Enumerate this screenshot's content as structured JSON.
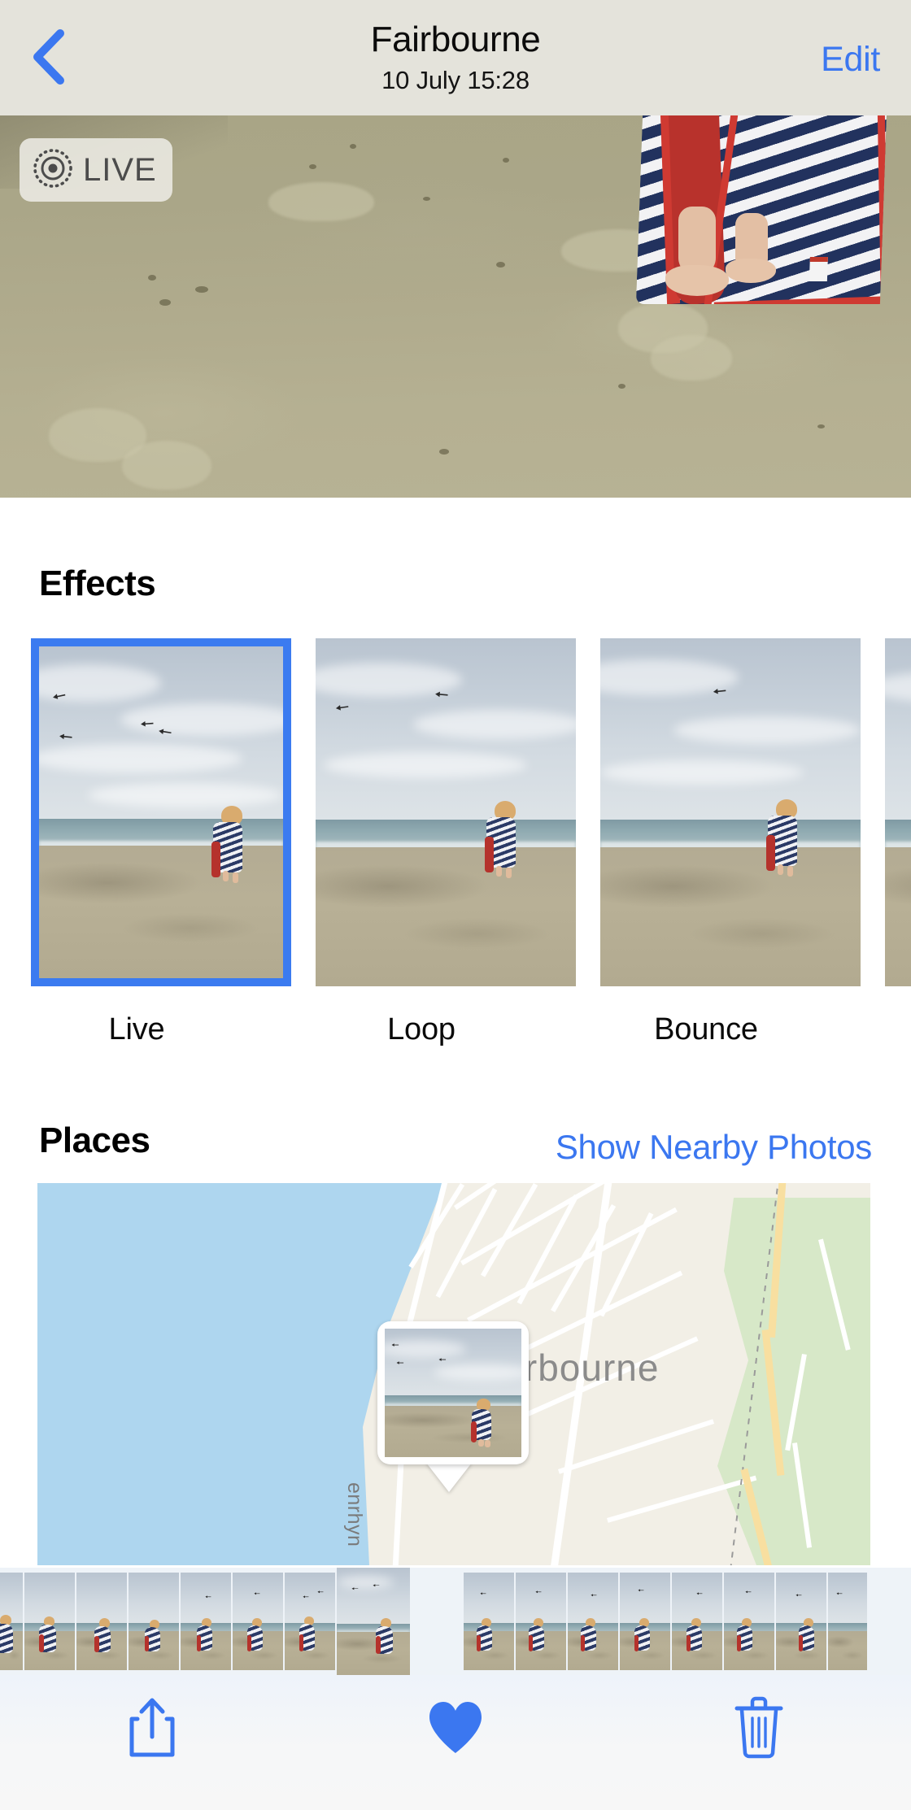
{
  "navbar": {
    "back_icon": "chevron-left-icon",
    "title": "Fairbourne",
    "subtitle": "10 July  15:28",
    "edit_label": "Edit",
    "accent_color": "#3b77f0",
    "background_color": "#e4e3db"
  },
  "hero": {
    "live_badge": {
      "icon": "live-photo-icon",
      "label": "LIVE"
    },
    "description": "Beach sand with a child's bare legs and a navy-and-white striped towel with red trim at upper right"
  },
  "effects": {
    "heading": "Effects",
    "items": [
      {
        "label": "Live",
        "selected": true
      },
      {
        "label": "Loop",
        "selected": false
      },
      {
        "label": "Bounce",
        "selected": false
      },
      {
        "label": "",
        "selected": false
      }
    ],
    "selected_border_color": "#3b7bf0"
  },
  "places": {
    "heading": "Places",
    "link_label": "Show Nearby Photos",
    "link_color": "#3b77f0",
    "map": {
      "place_label": "Fairbourne",
      "street_label": "enrhyn",
      "sea_color": "#aed6ef",
      "land_color": "#f3f0e7",
      "park_color": "#d7e8c8",
      "road_color": "#ffffff",
      "highway_color": "#f8dfa0",
      "pin_type": "photo-callout-pin"
    }
  },
  "filmstrip": {
    "selected_index": 7,
    "item_count": 16
  },
  "toolbar": {
    "share_icon": "share-icon",
    "favorite_icon": "heart-filled-icon",
    "delete_icon": "trash-icon",
    "icon_color": "#3b77f0",
    "favorite_active": true
  }
}
